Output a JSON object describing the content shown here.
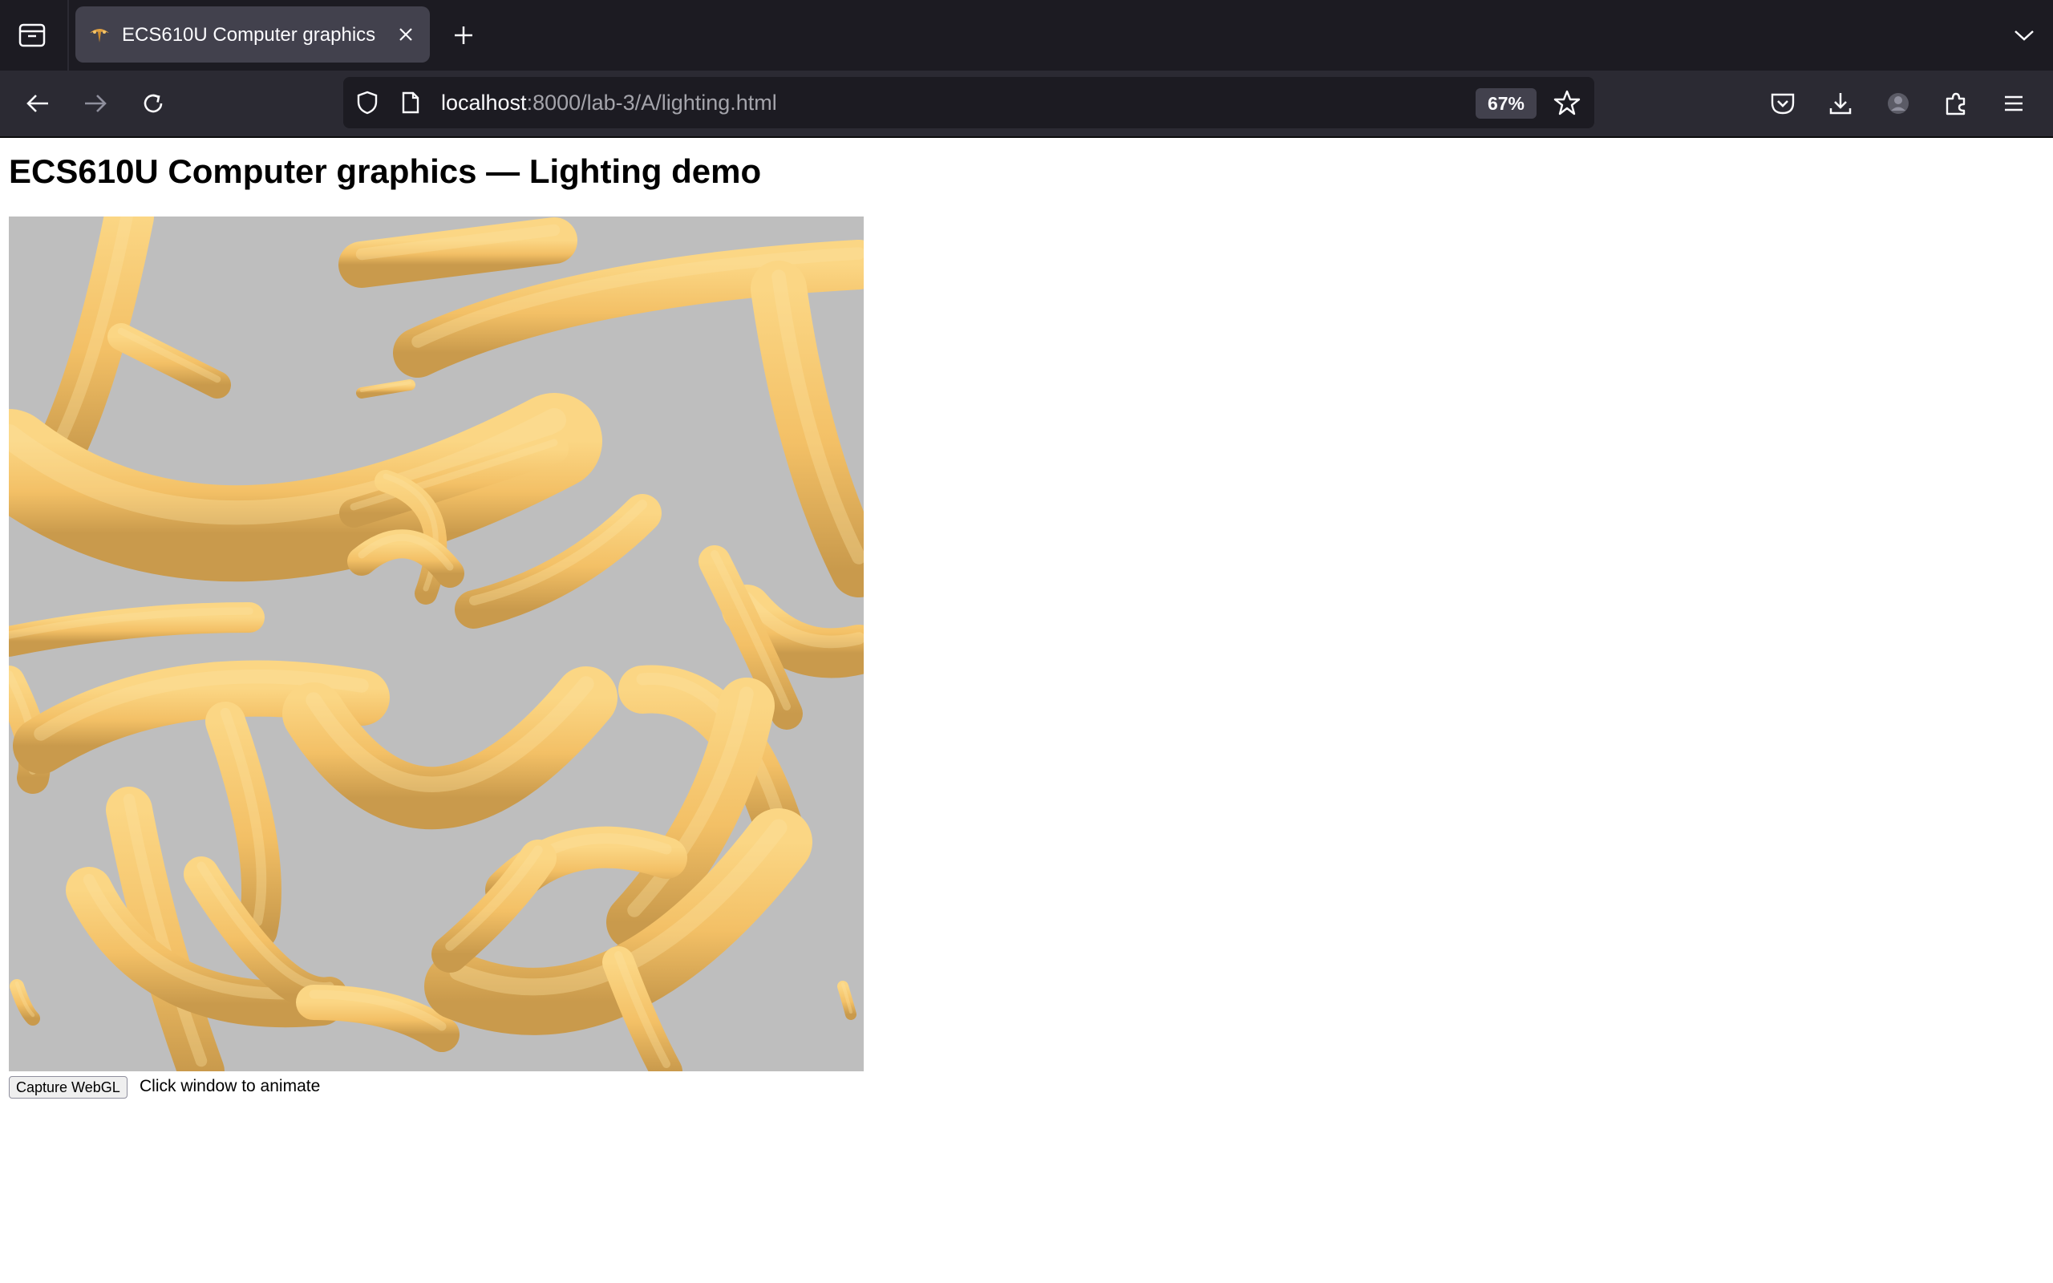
{
  "browser": {
    "tab": {
      "title": "ECS610U Computer graphics"
    },
    "url": {
      "host": "localhost",
      "rest": ":8000/lab-3/A/lighting.html"
    },
    "zoom": "67%"
  },
  "page": {
    "title": "ECS610U Computer graphics — Lighting demo",
    "capture_button": "Capture WebGL",
    "hint": "Click window to animate"
  },
  "scene": {
    "background": "#bebebe",
    "banana_color": "#f7c46a",
    "object": "banana"
  },
  "colors": {
    "chrome_dark": "#1c1b22",
    "chrome_mid": "#2b2a33",
    "tab_active": "#42414d"
  }
}
